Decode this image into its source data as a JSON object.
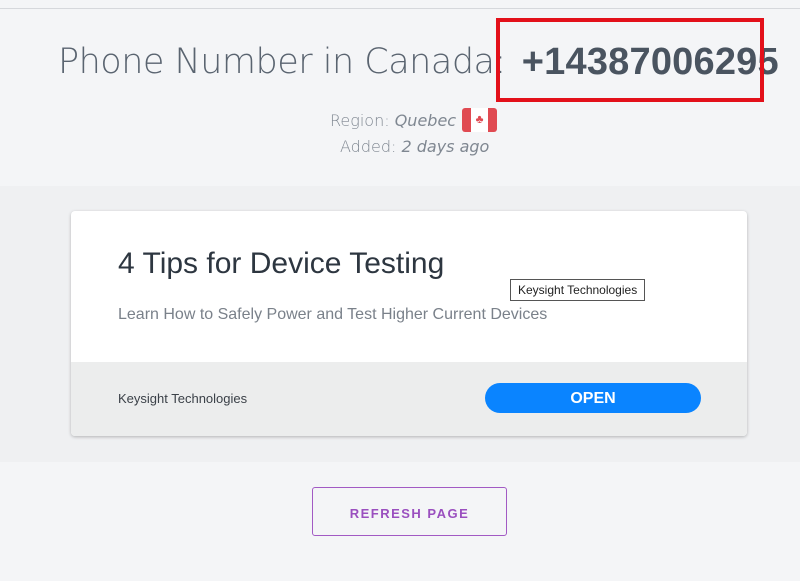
{
  "header": {
    "label": "Phone Number in Canada:",
    "phone_number": "+14387006295"
  },
  "meta": {
    "region_label": "Region:",
    "region_value": "Quebec",
    "flag_icon": "canada-flag-icon",
    "added_label": "Added:",
    "added_value": "2 days ago"
  },
  "ad": {
    "title": "4 Tips for Device Testing",
    "description": "Learn How to Safely Power and Test Higher Current Devices",
    "tooltip": "Keysight Technologies",
    "advertiser": "Keysight Technologies",
    "cta_label": "OPEN",
    "cta_color": "#0a84ff"
  },
  "actions": {
    "refresh_label": "REFRESH PAGE",
    "refresh_color": "#9a4fbf"
  },
  "annotation": {
    "highlight_color": "#e3101a"
  }
}
